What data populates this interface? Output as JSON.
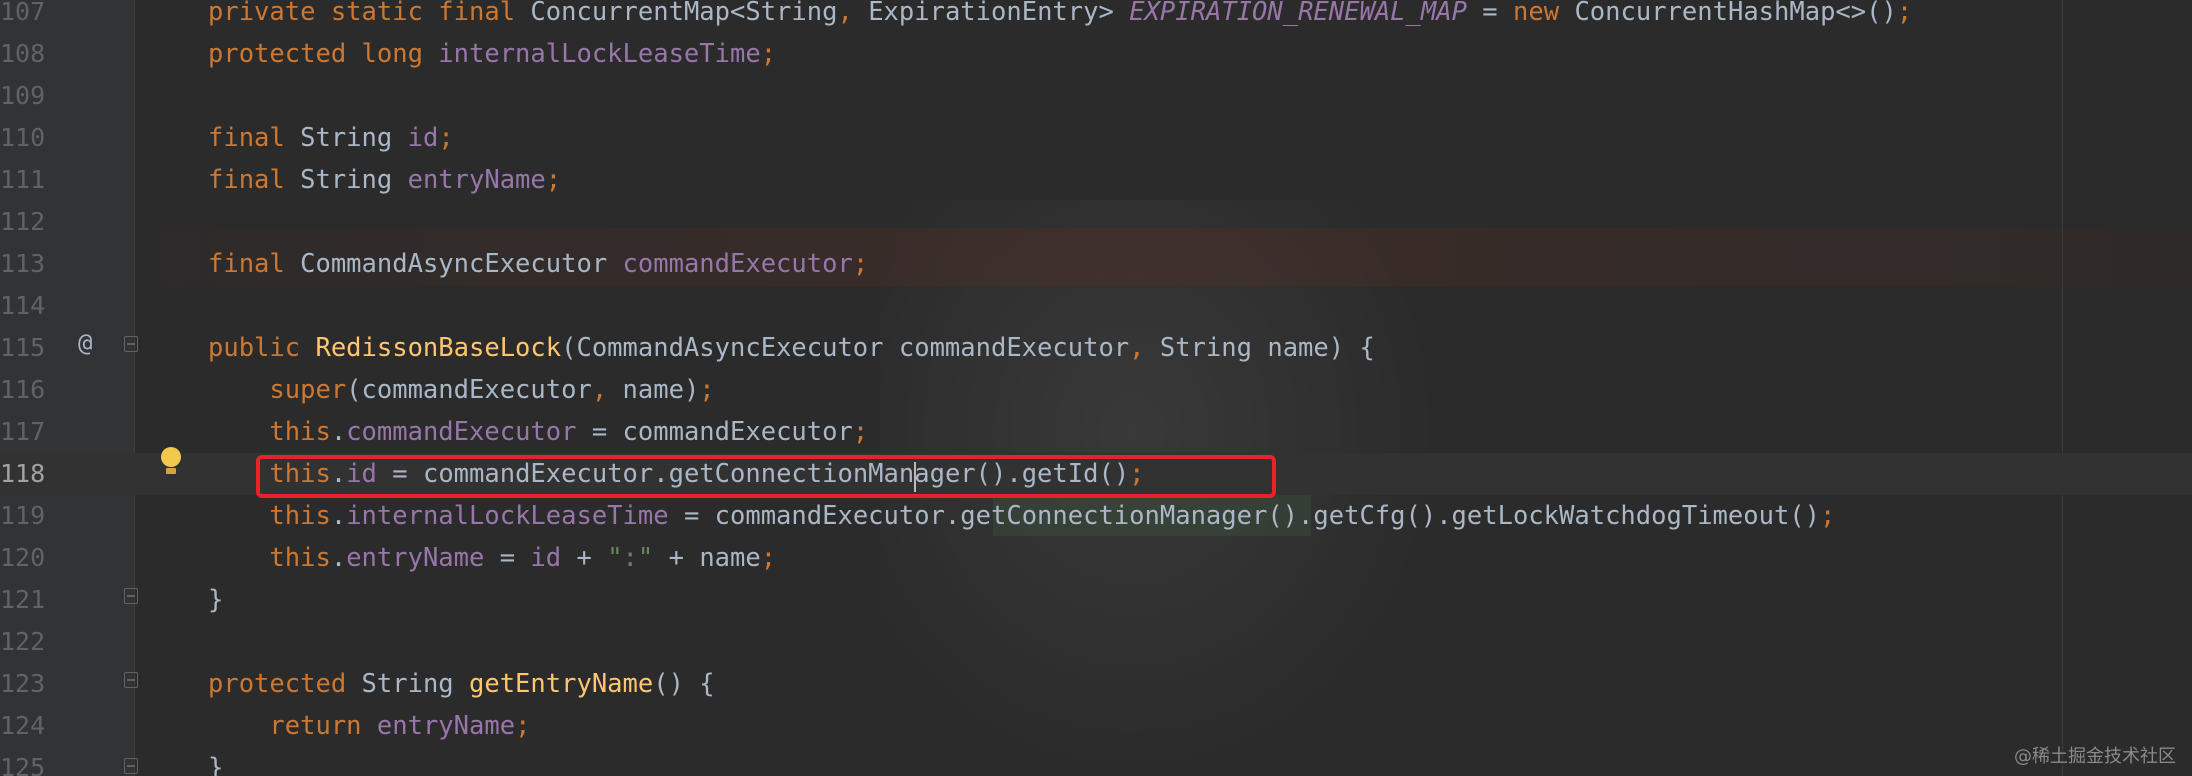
{
  "editor": {
    "language": "java",
    "lines": [
      {
        "num": "107",
        "tokens": [
          {
            "t": "private ",
            "c": "kw"
          },
          {
            "t": "static ",
            "c": "kw"
          },
          {
            "t": "final ",
            "c": "kw"
          },
          {
            "t": "ConcurrentMap<String",
            "c": ""
          },
          {
            "t": ", ",
            "c": "pun"
          },
          {
            "t": "ExpirationEntry> ",
            "c": ""
          },
          {
            "t": "EXPIRATION_RENEWAL_MAP",
            "c": "sfld"
          },
          {
            "t": " = ",
            "c": ""
          },
          {
            "t": "new ",
            "c": "kw"
          },
          {
            "t": "ConcurrentHashMap<>()",
            "c": ""
          },
          {
            "t": ";",
            "c": "pun"
          }
        ]
      },
      {
        "num": "108",
        "tokens": [
          {
            "t": "protected ",
            "c": "kw"
          },
          {
            "t": "long ",
            "c": "kw"
          },
          {
            "t": "internalLockLeaseTime",
            "c": "fld"
          },
          {
            "t": ";",
            "c": "pun"
          }
        ]
      },
      {
        "num": "109",
        "tokens": []
      },
      {
        "num": "110",
        "tokens": [
          {
            "t": "final ",
            "c": "kw"
          },
          {
            "t": "String ",
            "c": ""
          },
          {
            "t": "id",
            "c": "fld"
          },
          {
            "t": ";",
            "c": "pun"
          }
        ]
      },
      {
        "num": "111",
        "tokens": [
          {
            "t": "final ",
            "c": "kw"
          },
          {
            "t": "String ",
            "c": ""
          },
          {
            "t": "entryName",
            "c": "fld"
          },
          {
            "t": ";",
            "c": "pun"
          }
        ]
      },
      {
        "num": "112",
        "tokens": []
      },
      {
        "num": "113",
        "tokens": [
          {
            "t": "final ",
            "c": "kw"
          },
          {
            "t": "CommandAsyncExecutor ",
            "c": ""
          },
          {
            "t": "commandExecutor",
            "c": "fld"
          },
          {
            "t": ";",
            "c": "pun"
          }
        ]
      },
      {
        "num": "114",
        "tokens": []
      },
      {
        "num": "115",
        "tokens": [
          {
            "t": "public ",
            "c": "kw"
          },
          {
            "t": "RedissonBaseLock",
            "c": "mth"
          },
          {
            "t": "(CommandAsyncExecutor commandExecutor",
            "c": ""
          },
          {
            "t": ", ",
            "c": "pun"
          },
          {
            "t": "String name) {",
            "c": ""
          }
        ]
      },
      {
        "num": "116",
        "tokens": [
          {
            "t": "    super",
            "c": "kw"
          },
          {
            "t": "(commandExecutor",
            "c": ""
          },
          {
            "t": ", ",
            "c": "pun"
          },
          {
            "t": "name)",
            "c": ""
          },
          {
            "t": ";",
            "c": "pun"
          }
        ]
      },
      {
        "num": "117",
        "tokens": [
          {
            "t": "    this",
            "c": "kw"
          },
          {
            "t": ".",
            "c": ""
          },
          {
            "t": "commandExecutor",
            "c": "fld"
          },
          {
            "t": " = commandExecutor",
            "c": ""
          },
          {
            "t": ";",
            "c": "pun"
          }
        ]
      },
      {
        "num": "118",
        "tokens": [
          {
            "t": "    this",
            "c": "kw"
          },
          {
            "t": ".",
            "c": ""
          },
          {
            "t": "id",
            "c": "fld"
          },
          {
            "t": " = commandExecutor.getConnectionManager().getId()",
            "c": ""
          },
          {
            "t": ";",
            "c": "pun"
          }
        ]
      },
      {
        "num": "119",
        "tokens": [
          {
            "t": "    this",
            "c": "kw"
          },
          {
            "t": ".",
            "c": ""
          },
          {
            "t": "internalLockLeaseTime",
            "c": "fld"
          },
          {
            "t": " = commandExecutor.getConnectionManager().getCfg().getLockWatchdogTimeout()",
            "c": ""
          },
          {
            "t": ";",
            "c": "pun"
          }
        ]
      },
      {
        "num": "120",
        "tokens": [
          {
            "t": "    this",
            "c": "kw"
          },
          {
            "t": ".",
            "c": ""
          },
          {
            "t": "entryName",
            "c": "fld"
          },
          {
            "t": " = ",
            "c": ""
          },
          {
            "t": "id",
            "c": "fld"
          },
          {
            "t": " + ",
            "c": ""
          },
          {
            "t": "\":\"",
            "c": "str"
          },
          {
            "t": " + name",
            "c": ""
          },
          {
            "t": ";",
            "c": "pun"
          }
        ]
      },
      {
        "num": "121",
        "tokens": [
          {
            "t": "}",
            "c": ""
          }
        ]
      },
      {
        "num": "122",
        "tokens": []
      },
      {
        "num": "123",
        "tokens": [
          {
            "t": "protected ",
            "c": "kw"
          },
          {
            "t": "String ",
            "c": ""
          },
          {
            "t": "getEntryName",
            "c": "mth"
          },
          {
            "t": "() {",
            "c": ""
          }
        ]
      },
      {
        "num": "124",
        "tokens": [
          {
            "t": "    return ",
            "c": "kw"
          },
          {
            "t": "entryName",
            "c": "fld"
          },
          {
            "t": ";",
            "c": "pun"
          }
        ]
      },
      {
        "num": "125",
        "tokens": [
          {
            "t": "}",
            "c": ""
          }
        ]
      }
    ],
    "current_line": "118",
    "annotation_icon": "@",
    "highlighted_line": "118"
  },
  "gutter_icons": {
    "override": "at-sign-icon",
    "intention": "lightbulb-icon",
    "fold": "fold-marker-icon"
  },
  "watermark": "@稀土掘金技术社区",
  "colors": {
    "background": "#2b2b2b",
    "keyword": "#cc7832",
    "field": "#9876aa",
    "method": "#ffc66d",
    "string": "#6a8759",
    "text": "#a9b7c6",
    "highlight_box": "#e8222a"
  }
}
